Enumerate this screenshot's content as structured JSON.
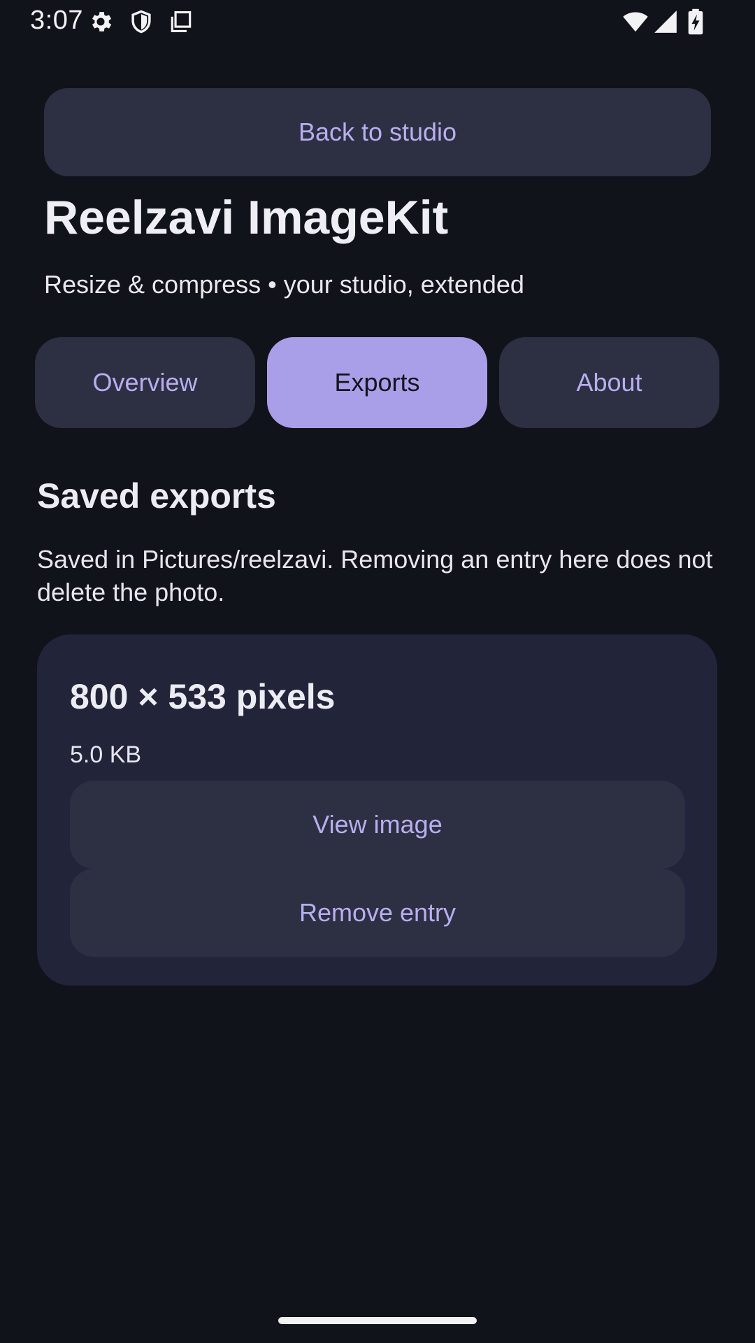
{
  "status_bar": {
    "time": "3:07",
    "left_icons": [
      "gear-icon",
      "shield-icon",
      "copy-icon"
    ],
    "right_icons": [
      "wifi-icon",
      "signal-icon",
      "battery-charging-icon"
    ]
  },
  "header": {
    "back_label": "Back to studio",
    "title": "Reelzavi ImageKit",
    "subtitle": "Resize & compress • your studio, extended"
  },
  "tabs": [
    {
      "label": "Overview",
      "active": false
    },
    {
      "label": "Exports",
      "active": true
    },
    {
      "label": "About",
      "active": false
    }
  ],
  "exports_section": {
    "title": "Saved exports",
    "description": "Saved in Pictures/reelzavi. Removing an entry here does not delete the photo.",
    "items": [
      {
        "dimensions": "800 × 533 pixels",
        "size": "5.0 KB",
        "view_label": "View image",
        "remove_label": "Remove entry"
      }
    ]
  },
  "colors": {
    "background": "#11131b",
    "surface": "#2d3042",
    "card": "#22253a",
    "accent": "#a99fe8",
    "accent_text": "#b8aef0"
  }
}
